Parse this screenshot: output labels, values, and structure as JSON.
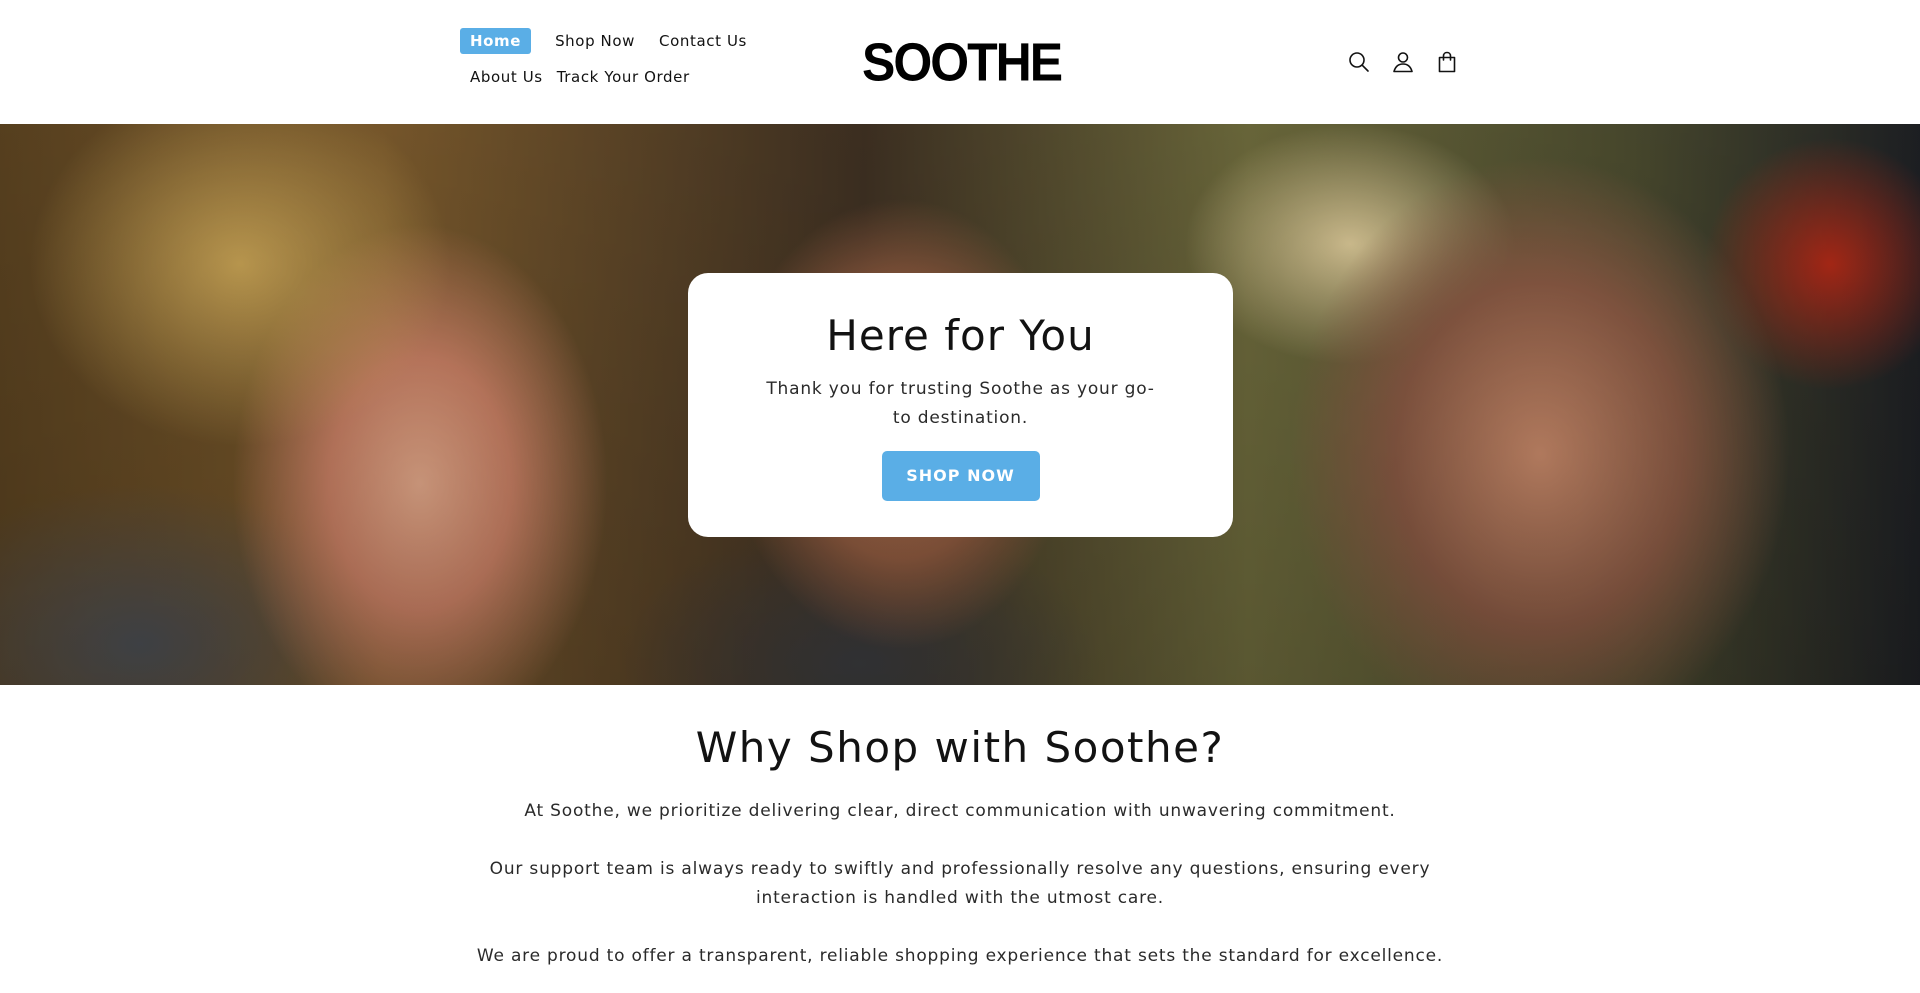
{
  "header": {
    "nav": [
      {
        "label": "Home",
        "active": true
      },
      {
        "label": "Shop Now",
        "active": false
      },
      {
        "label": "Contact Us",
        "active": false
      },
      {
        "label": "About Us",
        "active": false
      },
      {
        "label": "Track Your Order",
        "active": false
      }
    ],
    "logo": "SOOTHE",
    "icons": [
      "search-icon",
      "account-icon",
      "cart-icon"
    ]
  },
  "hero": {
    "title": "Here for You",
    "text": "Thank you for trusting Soothe as your go-to destination.",
    "button_label": "SHOP NOW"
  },
  "why": {
    "title": "Why Shop with Soothe?",
    "paragraphs": [
      "At Soothe, we prioritize delivering clear, direct communication with unwavering commitment.",
      "Our support team is always ready to swiftly and professionally resolve any questions, ensuring every interaction is handled with the utmost care.",
      "We are proud to offer a transparent, reliable shopping experience that sets the standard for excellence."
    ]
  },
  "colors": {
    "accent": "#5aaee6",
    "text": "#121212",
    "background": "#ffffff"
  }
}
